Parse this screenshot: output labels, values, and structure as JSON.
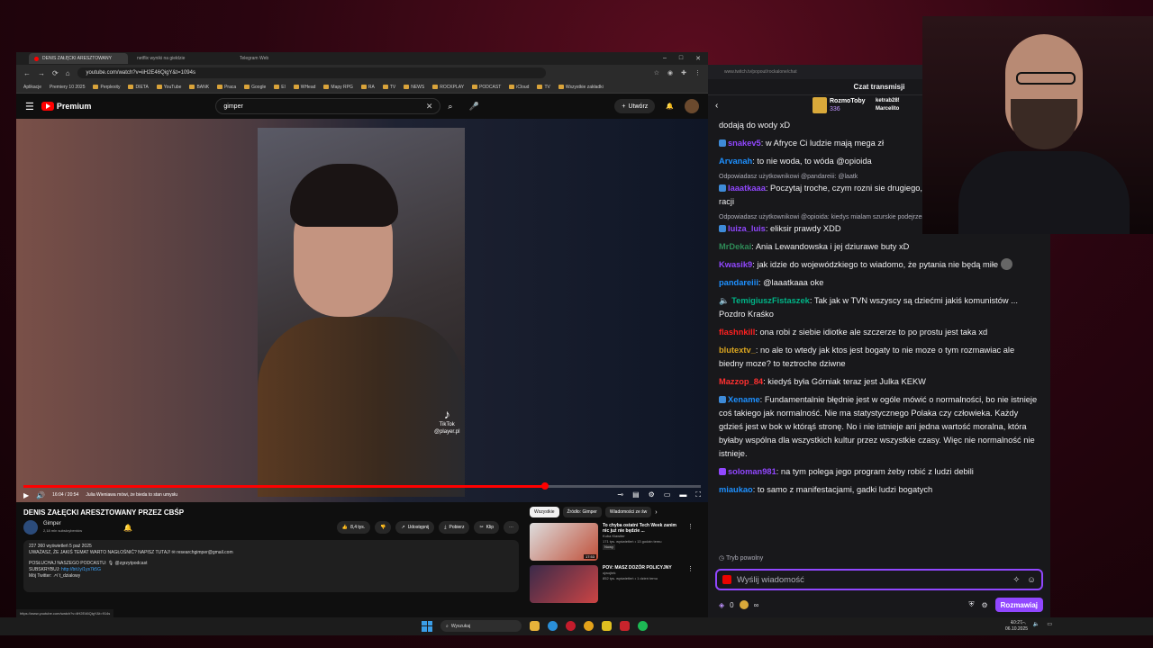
{
  "browser": {
    "tabs": [
      {
        "label": "DENIS ZAŁĘCKI ARESZTOWANY",
        "active": true
      },
      {
        "label": "netflix wyniki na giełdzie",
        "active": false
      },
      {
        "label": "Telegram Web",
        "active": false
      }
    ],
    "url": "youtube.com/watch?v=iiH2E46QigY&t=1094s",
    "bookmarks": [
      "Aplikacje",
      "Premiery 10 2025",
      "Perplexity",
      "DIETA",
      "YouTube",
      "BANK",
      "Praca",
      "Google",
      "El",
      "WHead",
      "Mapy RPG",
      "RA",
      "TV",
      "NEWS",
      "ROCKPLAY",
      "PODCAST",
      "iCloud",
      "TV",
      "Wszystkie zakładki"
    ]
  },
  "youtube": {
    "logo": "Premium",
    "search_value": "gimper",
    "create_label": "Utwórz",
    "player": {
      "time": "16:04 / 20:54",
      "chapter": "Julia Wieniawa mówi, że bieda to stan umysłu",
      "progress": 0.77,
      "tiktok_label": "TikTok",
      "tiktok_handle": "@player.pl"
    },
    "video_title": "DENIS ZAŁĘCKI ARESZTOWANY PRZEZ CBŚP",
    "channel": {
      "name": "Gimper",
      "subs": "2,18 mln subskrybentów"
    },
    "actions": {
      "likes": "8,4 tys.",
      "share": "Udostępnij",
      "download": "Pobierz",
      "clip": "Klip"
    },
    "description": {
      "stats": "227 360 wyświetleń  5 paź 2025",
      "line1": "UWAŻASZ, ŻE JAKIŚ TEMAT WARTO NAGŁOŚNIĆ? NAPISZ TUTAJ! ✉ researchgimper@gmail.com",
      "line2": "POSŁUCHAJ NASZEGO PODCASTU: 🎙 @zgrzytpodcast",
      "line3_label": "SUBSKRYBUJ:",
      "line3_link": "http://bit.ly/1ys7k5G",
      "line4": "Mój Twitter:  ↗/ t_dzialowy"
    },
    "chips": [
      "Wszystkie",
      "Źródło: Gimper",
      "Wiadomości ze św"
    ],
    "recommendations": [
      {
        "title": "To chyba ostatni Tech Week zanim nic już nie będzie ...",
        "channel": "Kuba Klawiter",
        "meta": "171 tys. wyświetleń • 13 godzin temu",
        "badge": "Nowy",
        "duration": "17:53"
      },
      {
        "title": "POV: MASZ DOZÓR POLICYJNY",
        "channel": "ojwojtek",
        "meta": "852 tys. wyświetleń • 1 dzień temu",
        "badge": "",
        "duration": ""
      }
    ],
    "status_url": "https://www.youtube.com/watch?v=iiH2E46QigY&t=914s"
  },
  "chat": {
    "url": "www.twitch.tv/popout/rockalone/chat",
    "header": "Czat transmisji",
    "gifter1_name": "RozmoToby",
    "gifter1_count": "336",
    "gifter2_name1": "ketrab28!",
    "gifter2_name2": "Marcelito",
    "messages": [
      {
        "user": "",
        "color": "#efeff1",
        "text": "dodają do wody xD"
      },
      {
        "user": "snakev5",
        "color": "#9147ff",
        "text": "w Afryce Ci ludzie mają mega zł"
      },
      {
        "user": "Arvanah",
        "color": "#1e90ff",
        "text": "to nie woda, to wóda  @opioida"
      },
      {
        "user": "laaatkaaa",
        "color": "#9147ff",
        "reply": "Odpowiadasz użytkownikowi @pandareiii: @laatk",
        "text": "Poczytaj troche, czym rozni sie drugiego, a potem badz pewny swoich racji"
      },
      {
        "user": "luiza_luis",
        "color": "#9147ff",
        "reply": "Odpowiadasz użytkownikowi @opioida: kiedys mialam szurskie podejrzenie ze ...",
        "text": "eliksir prawdy XDD"
      },
      {
        "user": "MrDekai",
        "color": "#2e8b57",
        "text": "Ania Lewandowska i jej dziurawe buty xD"
      },
      {
        "user": "Kwasik9",
        "color": "#9147ff",
        "text": "jak idzie do wojewódzkiego to wiadomo, że pytania nie będą miłe"
      },
      {
        "user": "pandareiii",
        "color": "#1e90ff",
        "text": "@laaatkaaa oke"
      },
      {
        "user": "TemigiuszFistaszek",
        "color": "#00b386",
        "text": "Tak jak w TVN wszyscy są dziećmi jakiś komunistów ... Pozdro Kraśko"
      },
      {
        "user": "flashnkill",
        "color": "#ff2020",
        "text": "ona robi z siebie idiotke ale szczerze to po prostu jest taka xd"
      },
      {
        "user": "blutextv_",
        "color": "#daa520",
        "text": "no ale to wtedy jak ktos jest bogaty to nie moze o tym rozmawiac ale biedny moze? to teztroche dziwne"
      },
      {
        "user": "Mazzop_84",
        "color": "#ff3030",
        "text": "kiedyś była Górniak teraz jest Julka KEKW"
      },
      {
        "user": "Xename",
        "color": "#1e90ff",
        "text": "Fundamentalnie błędnie jest w ogóle mówić o normalności, bo nie istnieje coś takiego jak normalność. Nie ma statystycznego Polaka czy człowieka. Każdy gdzieś jest w bok w którąś stronę. No i nie istnieje ani jedna wartość moralna, która byłaby wspólna dla wszystkich kultur przez wszystkie czasy. Więc nie normalność nie istnieje."
      },
      {
        "user": "soloman981",
        "color": "#9147ff",
        "text": "na tym polega jego program żeby robić z ludzi debili"
      },
      {
        "user": "miaukao",
        "color": "#1e90ff",
        "text": "to samo z manifestacjami, gadki ludzi bogatych"
      }
    ],
    "slow_mode": "Tryb powolny",
    "input_placeholder": "Wyślij wiadomość",
    "points": "0",
    "send_label": "Rozmawiaj"
  },
  "taskbar": {
    "search": "Wyszukaj",
    "time": "10:27",
    "date": "06.10.2025"
  }
}
